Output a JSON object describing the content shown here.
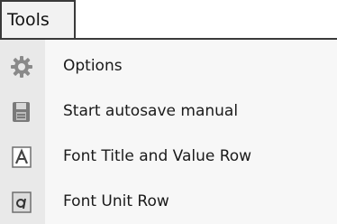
{
  "menubar": {
    "title": "Tools"
  },
  "menu": {
    "items": [
      {
        "label": "Options",
        "icon": "gear-icon"
      },
      {
        "label": "Start autosave manual",
        "icon": "floppy-save-icon"
      },
      {
        "label": "Font Title and Value Row",
        "icon": "font-letter-a-icon"
      },
      {
        "label": "Font Unit Row",
        "icon": "font-italic-a-icon"
      }
    ]
  }
}
